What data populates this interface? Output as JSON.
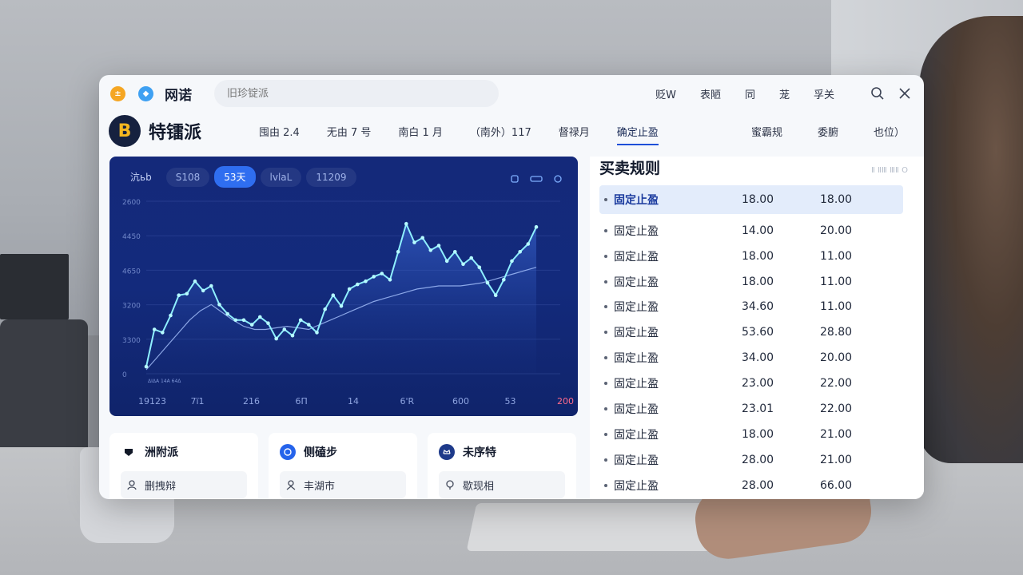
{
  "titlebar": {
    "app_name": "网诺",
    "search_placeholder": "旧珍锭派",
    "links": [
      "贬W",
      "表陋",
      "同",
      "茏",
      "孚关"
    ]
  },
  "brand": {
    "logo_glyph": "B",
    "name": "特镭派"
  },
  "tabs": [
    "囤由 2.4",
    "无由 7 号",
    "南白 1 月",
    "（南外）117",
    "督禄月",
    "确定止盈"
  ],
  "active_tab_index": 5,
  "nav_right": [
    "蜜霸规",
    "委腑",
    "也位）"
  ],
  "chart_toolbar": {
    "pills": [
      "沆ьb",
      "S108",
      "53天",
      "lvlaL",
      "11209"
    ],
    "active_index": 2
  },
  "chart_data": {
    "type": "line",
    "y_ticks": [
      "2600",
      "4450",
      "4650",
      "3200",
      "3300",
      "0"
    ],
    "x_ticks": [
      "19123",
      "7ï1",
      "216",
      "6Π",
      "14",
      "6'R",
      "600",
      "53",
      "200"
    ],
    "ylim": [
      0,
      1
    ],
    "series": [
      {
        "values": [
          0.2,
          0.44,
          0.42,
          0.53,
          0.66,
          0.67,
          0.75,
          0.69,
          0.72,
          0.6,
          0.54,
          0.5,
          0.5,
          0.47,
          0.52,
          0.48,
          0.38,
          0.44,
          0.4,
          0.5,
          0.47,
          0.42,
          0.57,
          0.66,
          0.59,
          0.7,
          0.73,
          0.75,
          0.78,
          0.8,
          0.76,
          0.94,
          1.12,
          1.0,
          1.03,
          0.95,
          0.98,
          0.88,
          0.94,
          0.86,
          0.9,
          0.84,
          0.74,
          0.66,
          0.76,
          0.88,
          0.94,
          0.99,
          1.1
        ]
      },
      {
        "values": [
          0.18,
          0.26,
          0.34,
          0.42,
          0.5,
          0.56,
          0.6,
          0.55,
          0.5,
          0.46,
          0.44,
          0.44,
          0.45,
          0.46,
          0.45,
          0.44,
          0.47,
          0.5,
          0.53,
          0.56,
          0.59,
          0.62,
          0.64,
          0.66,
          0.68,
          0.7,
          0.71,
          0.72,
          0.72,
          0.72,
          0.73,
          0.74,
          0.76,
          0.78,
          0.8,
          0.82,
          0.84
        ]
      }
    ],
    "legend_text": "ΔΙΔΑ 14Α 64Δ"
  },
  "cards": [
    {
      "title": "洲附派",
      "sub": "删拽辩",
      "icon": "tag-icon",
      "color": "#111827"
    },
    {
      "title": "侧磕步",
      "sub": "丰湖市",
      "icon": "chat-icon",
      "color": "#2563eb"
    },
    {
      "title": "未序特",
      "sub": "歇现相",
      "icon": "crown-icon",
      "color": "#1e3a8a"
    }
  ],
  "rules": {
    "title": "买卖规则",
    "meta": "Ⅱ ⅡⅢ ⅢⅡ O",
    "rows": [
      {
        "name": "固定止盈",
        "a": "18.00",
        "b": "18.00"
      },
      {
        "name": "固定止盈",
        "a": "14.00",
        "b": "20.00"
      },
      {
        "name": "固定止盈",
        "a": "18.00",
        "b": "11.00"
      },
      {
        "name": "固定止盈",
        "a": "18.00",
        "b": "11.00"
      },
      {
        "name": "固定止盈",
        "a": "34.60",
        "b": "11.00"
      },
      {
        "name": "固定止盈",
        "a": "53.60",
        "b": "28.80"
      },
      {
        "name": "固定止盈",
        "a": "34.00",
        "b": "20.00"
      },
      {
        "name": "固定止盈",
        "a": "23.00",
        "b": "22.00"
      },
      {
        "name": "固定止盈",
        "a": "23.01",
        "b": "22.00"
      },
      {
        "name": "固定止盈",
        "a": "18.00",
        "b": "21.00"
      },
      {
        "name": "固定止盈",
        "a": "28.00",
        "b": "21.00"
      },
      {
        "name": "固定止盈",
        "a": "28.00",
        "b": "66.00"
      }
    ]
  }
}
